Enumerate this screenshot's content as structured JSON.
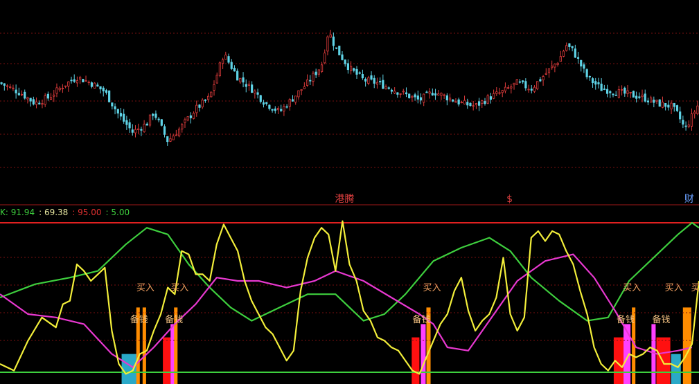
{
  "chart_data": [
    {
      "type": "candlestick",
      "panel": "price",
      "colors": {
        "up": "#e03c3c",
        "down": "#5fd3e6",
        "grid": "#7a1010"
      },
      "ylim": [
        0,
        100
      ],
      "close_path": [
        [
          0,
          62
        ],
        [
          3,
          55
        ],
        [
          5,
          48
        ],
        [
          7,
          52
        ],
        [
          9,
          60
        ],
        [
          11,
          66
        ],
        [
          13,
          62
        ],
        [
          15,
          56
        ],
        [
          17,
          40
        ],
        [
          19,
          28
        ],
        [
          21,
          34
        ],
        [
          22,
          42
        ],
        [
          24,
          22
        ],
        [
          26,
          32
        ],
        [
          28,
          44
        ],
        [
          30,
          52
        ],
        [
          32,
          82
        ],
        [
          34,
          66
        ],
        [
          36,
          58
        ],
        [
          38,
          48
        ],
        [
          40,
          42
        ],
        [
          42,
          52
        ],
        [
          44,
          62
        ],
        [
          46,
          74
        ],
        [
          47,
          98
        ],
        [
          48,
          86
        ],
        [
          50,
          72
        ],
        [
          52,
          64
        ],
        [
          54,
          62
        ],
        [
          56,
          58
        ],
        [
          58,
          54
        ],
        [
          60,
          50
        ],
        [
          62,
          56
        ],
        [
          64,
          52
        ],
        [
          66,
          48
        ],
        [
          68,
          46
        ],
        [
          70,
          52
        ],
        [
          72,
          56
        ],
        [
          74,
          62
        ],
        [
          76,
          58
        ],
        [
          78,
          68
        ],
        [
          80,
          78
        ],
        [
          81,
          88
        ],
        [
          82,
          84
        ],
        [
          84,
          66
        ],
        [
          86,
          58
        ],
        [
          88,
          56
        ],
        [
          90,
          54
        ],
        [
          92,
          52
        ],
        [
          94,
          48
        ],
        [
          96,
          46
        ],
        [
          97,
          40
        ],
        [
          98,
          30
        ],
        [
          100,
          48
        ]
      ],
      "bottom_markers": [
        {
          "x_pct": 49.3,
          "text": "港腾",
          "color": "#e04040"
        },
        {
          "x_pct": 72.9,
          "text": "$",
          "color": "#e04040"
        },
        {
          "x_pct": 98.6,
          "text": "财",
          "color": "#6aa0ff"
        }
      ]
    },
    {
      "type": "line",
      "panel": "indicator",
      "ylim": [
        0,
        100
      ],
      "readout": [
        {
          "text": "K: 91.94",
          "color": "#3ecf3e"
        },
        {
          "text": ": 69.38",
          "color": "#e8e8a0"
        },
        {
          "text": ": 95.00",
          "color": "#e03030"
        },
        {
          "text": ": 5.00",
          "color": "#3ecf3e"
        }
      ],
      "ref_lines": [
        {
          "value": 95,
          "color": "#e02020"
        },
        {
          "value": 5,
          "color": "#3ecf3e"
        }
      ],
      "series": [
        {
          "color": "#3ecf3e",
          "points": [
            [
              0,
              50
            ],
            [
              5,
              58
            ],
            [
              10,
              62
            ],
            [
              14,
              66
            ],
            [
              18,
              82
            ],
            [
              21,
              92
            ],
            [
              24,
              88
            ],
            [
              27,
              70
            ],
            [
              30,
              56
            ],
            [
              33,
              44
            ],
            [
              36,
              36
            ],
            [
              40,
              44
            ],
            [
              44,
              52
            ],
            [
              48,
              52
            ],
            [
              52,
              36
            ],
            [
              55,
              40
            ],
            [
              58,
              52
            ],
            [
              62,
              72
            ],
            [
              66,
              80
            ],
            [
              70,
              86
            ],
            [
              73,
              78
            ],
            [
              76,
              62
            ],
            [
              80,
              48
            ],
            [
              84,
              36
            ],
            [
              87,
              38
            ],
            [
              90,
              60
            ],
            [
              94,
              76
            ],
            [
              97,
              88
            ],
            [
              99,
              95
            ],
            [
              100,
              92
            ]
          ]
        },
        {
          "color": "#e838d0",
          "points": [
            [
              0,
              52
            ],
            [
              4,
              40
            ],
            [
              8,
              38
            ],
            [
              12,
              34
            ],
            [
              16,
              16
            ],
            [
              19,
              8
            ],
            [
              22,
              20
            ],
            [
              25,
              34
            ],
            [
              28,
              46
            ],
            [
              31,
              62
            ],
            [
              34,
              60
            ],
            [
              37,
              60
            ],
            [
              41,
              56
            ],
            [
              45,
              60
            ],
            [
              48,
              66
            ],
            [
              52,
              60
            ],
            [
              56,
              50
            ],
            [
              60,
              40
            ],
            [
              62,
              34
            ],
            [
              64,
              20
            ],
            [
              67,
              18
            ],
            [
              70,
              36
            ],
            [
              74,
              60
            ],
            [
              78,
              72
            ],
            [
              82,
              76
            ],
            [
              85,
              62
            ],
            [
              88,
              42
            ],
            [
              91,
              20
            ],
            [
              94,
              16
            ],
            [
              97,
              18
            ],
            [
              99,
              20
            ]
          ]
        },
        {
          "color": "#f2ee3a",
          "points": [
            [
              0,
              10
            ],
            [
              2,
              6
            ],
            [
              4,
              24
            ],
            [
              6,
              38
            ],
            [
              8,
              32
            ],
            [
              9,
              46
            ],
            [
              10,
              48
            ],
            [
              11,
              70
            ],
            [
              12,
              66
            ],
            [
              13,
              60
            ],
            [
              14,
              64
            ],
            [
              15,
              68
            ],
            [
              16,
              30
            ],
            [
              17,
              10
            ],
            [
              18,
              4
            ],
            [
              19,
              6
            ],
            [
              20,
              16
            ],
            [
              21,
              18
            ],
            [
              22,
              30
            ],
            [
              23,
              40
            ],
            [
              24,
              56
            ],
            [
              25,
              52
            ],
            [
              26,
              78
            ],
            [
              27,
              76
            ],
            [
              28,
              64
            ],
            [
              29,
              64
            ],
            [
              30,
              60
            ],
            [
              31,
              82
            ],
            [
              32,
              94
            ],
            [
              33,
              86
            ],
            [
              34,
              78
            ],
            [
              35,
              60
            ],
            [
              36,
              48
            ],
            [
              37,
              40
            ],
            [
              38,
              32
            ],
            [
              39,
              28
            ],
            [
              40,
              20
            ],
            [
              41,
              12
            ],
            [
              42,
              18
            ],
            [
              43,
              54
            ],
            [
              44,
              74
            ],
            [
              45,
              86
            ],
            [
              46,
              92
            ],
            [
              47,
              88
            ],
            [
              48,
              66
            ],
            [
              49,
              96
            ],
            [
              50,
              70
            ],
            [
              51,
              60
            ],
            [
              52,
              42
            ],
            [
              53,
              36
            ],
            [
              54,
              26
            ],
            [
              55,
              24
            ],
            [
              56,
              20
            ],
            [
              57,
              18
            ],
            [
              58,
              12
            ],
            [
              59,
              6
            ],
            [
              60,
              4
            ],
            [
              61,
              14
            ],
            [
              62,
              24
            ],
            [
              63,
              34
            ],
            [
              64,
              40
            ],
            [
              65,
              54
            ],
            [
              66,
              62
            ],
            [
              67,
              42
            ],
            [
              68,
              30
            ],
            [
              69,
              36
            ],
            [
              70,
              40
            ],
            [
              71,
              50
            ],
            [
              72,
              74
            ],
            [
              73,
              40
            ],
            [
              74,
              30
            ],
            [
              75,
              38
            ],
            [
              76,
              86
            ],
            [
              77,
              90
            ],
            [
              78,
              84
            ],
            [
              79,
              90
            ],
            [
              80,
              88
            ],
            [
              81,
              78
            ],
            [
              82,
              70
            ],
            [
              83,
              54
            ],
            [
              84,
              40
            ],
            [
              85,
              20
            ],
            [
              86,
              10
            ],
            [
              87,
              6
            ],
            [
              88,
              12
            ],
            [
              89,
              8
            ],
            [
              90,
              16
            ],
            [
              91,
              14
            ],
            [
              92,
              16
            ],
            [
              93,
              20
            ],
            [
              94,
              18
            ],
            [
              95,
              10
            ],
            [
              96,
              10
            ],
            [
              97,
              8
            ],
            [
              98,
              14
            ],
            [
              99,
              22
            ],
            [
              100,
              60
            ]
          ]
        }
      ],
      "signals": [
        {
          "x_pct": 19.9,
          "text": "备钱",
          "color": "#f2c080"
        },
        {
          "x_pct": 20.8,
          "text": "买入",
          "color": "#f2a060"
        },
        {
          "x_pct": 24.9,
          "text": "备钱",
          "color": "#f2c080"
        },
        {
          "x_pct": 25.7,
          "text": "买入",
          "color": "#f2a060"
        },
        {
          "x_pct": 60.3,
          "text": "备钱",
          "color": "#f2c080"
        },
        {
          "x_pct": 61.8,
          "text": "买入",
          "color": "#f2a060"
        },
        {
          "x_pct": 89.5,
          "text": "备钱",
          "color": "#f2c080"
        },
        {
          "x_pct": 90.4,
          "text": "买入",
          "color": "#f2a060"
        },
        {
          "x_pct": 94.6,
          "text": "备钱",
          "color": "#f2c080"
        },
        {
          "x_pct": 96.4,
          "text": "买入",
          "color": "#f2a060"
        },
        {
          "x_pct": 99.5,
          "text": "买",
          "color": "#f2a060"
        }
      ],
      "bars": [
        {
          "x_pct": 17.4,
          "w_pct": 2.4,
          "value": 16,
          "color": "#2aa9c8"
        },
        {
          "x_pct": 19.5,
          "w_pct": 0.5,
          "value": 44,
          "color": "#ff8c00"
        },
        {
          "x_pct": 20.4,
          "w_pct": 0.5,
          "value": 44,
          "color": "#ff8c00"
        },
        {
          "x_pct": 23.3,
          "w_pct": 1.1,
          "value": 26,
          "color": "#ff1010"
        },
        {
          "x_pct": 24.4,
          "w_pct": 0.6,
          "value": 34,
          "color": "#ff40ff"
        },
        {
          "x_pct": 24.9,
          "w_pct": 0.5,
          "value": 44,
          "color": "#ff8c00"
        },
        {
          "x_pct": 58.9,
          "w_pct": 1.1,
          "value": 26,
          "color": "#ff1010"
        },
        {
          "x_pct": 60.2,
          "w_pct": 0.7,
          "value": 34,
          "color": "#ff40ff"
        },
        {
          "x_pct": 61.0,
          "w_pct": 0.6,
          "value": 44,
          "color": "#ff8c00"
        },
        {
          "x_pct": 87.8,
          "w_pct": 1.4,
          "value": 26,
          "color": "#ff1010"
        },
        {
          "x_pct": 89.2,
          "w_pct": 1.0,
          "value": 34,
          "color": "#ff40ff"
        },
        {
          "x_pct": 90.4,
          "w_pct": 0.5,
          "value": 44,
          "color": "#ff8c00"
        },
        {
          "x_pct": 93.2,
          "w_pct": 0.6,
          "value": 34,
          "color": "#ff40ff"
        },
        {
          "x_pct": 93.9,
          "w_pct": 2.0,
          "value": 26,
          "color": "#ff1010"
        },
        {
          "x_pct": 96.0,
          "w_pct": 1.4,
          "value": 16,
          "color": "#2aa9c8"
        },
        {
          "x_pct": 97.7,
          "w_pct": 1.2,
          "value": 44,
          "color": "#ff8c00"
        }
      ]
    }
  ]
}
